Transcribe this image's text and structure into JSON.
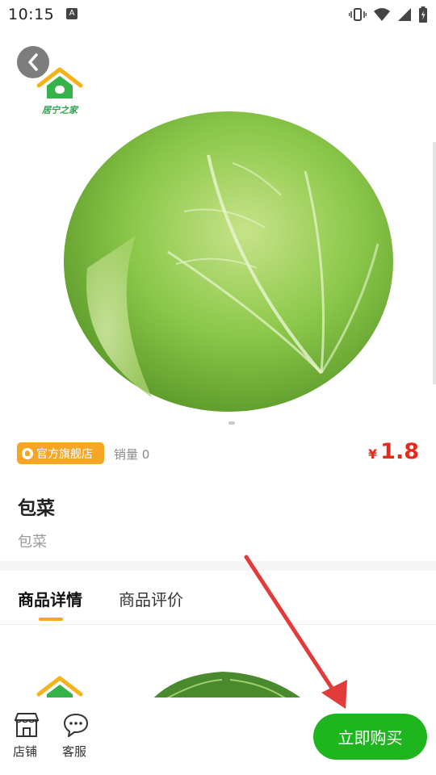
{
  "status_bar": {
    "time": "10:15",
    "keyboard_indicator": "A"
  },
  "logo": {
    "text": "居宁之家"
  },
  "product": {
    "store_badge": "官方旗舰店",
    "sales_label": "销量 0",
    "currency": "¥",
    "price": "1.8",
    "title": "包菜",
    "subtitle": "包菜"
  },
  "tabs": [
    {
      "label": "商品详情",
      "active": true
    },
    {
      "label": "商品评价",
      "active": false
    }
  ],
  "bottom_bar": {
    "store_label": "店铺",
    "service_label": "客服",
    "buy_label": "立即购买"
  },
  "colors": {
    "accent_orange": "#f6a623",
    "price_red": "#e52a1c",
    "buy_green": "#1fb51f",
    "annotation_red": "#e23b3b"
  }
}
